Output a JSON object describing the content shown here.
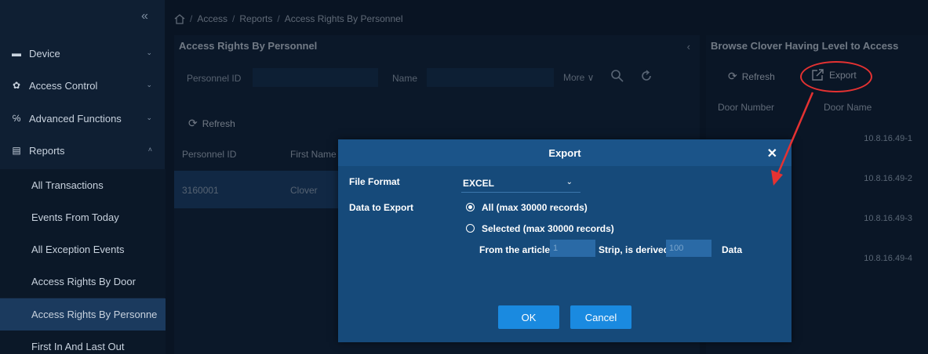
{
  "sidebar": {
    "collapse_label": "«",
    "menu": [
      {
        "icon": "device-icon",
        "glyph": "▬",
        "label": "Device",
        "chevron": "⌄"
      },
      {
        "icon": "gear-icon",
        "glyph": "✿",
        "label": "Access Control",
        "chevron": "⌄"
      },
      {
        "icon": "functions-icon",
        "glyph": "℅",
        "label": "Advanced Functions",
        "chevron": "⌄"
      },
      {
        "icon": "document-icon",
        "glyph": "▤",
        "label": "Reports",
        "chevron": "˄"
      }
    ],
    "sub_items": [
      "All Transactions",
      "Events From Today",
      "All Exception Events",
      "Access Rights By Door",
      "Access Rights By Personne",
      "First In And Last Out"
    ]
  },
  "breadcrumb": {
    "home_icon": "home-icon",
    "sep": "/",
    "items": [
      "Access",
      "Reports",
      "Access Rights By Personnel"
    ]
  },
  "left_panel": {
    "title": "Access Rights By Personnel",
    "collapse": "‹",
    "filter": {
      "personnel_id_label": "Personnel ID",
      "name_label": "Name",
      "more_label": "More ∨"
    },
    "refresh_label": "Refresh",
    "columns": [
      "Personnel ID",
      "First Name"
    ],
    "rows": [
      {
        "personnel_id": "3160001",
        "first_name": "Clover"
      }
    ]
  },
  "right_panel": {
    "title": "Browse Clover Having Level to Access",
    "refresh_label": "Refresh",
    "export_label": "Export",
    "columns": [
      "Door Number",
      "Door Name"
    ],
    "rows": [
      "10.8.16.49-1",
      "10.8.16.49-2",
      "10.8.16.49-3",
      "10.8.16.49-4"
    ]
  },
  "dialog": {
    "title": "Export",
    "close": "✕",
    "file_format_label": "File Format",
    "file_format_value": "EXCEL",
    "data_to_export_label": "Data to Export",
    "option_all": "All (max 30000 records)",
    "option_selected": "Selected (max 30000 records)",
    "from_article_label": "From the article",
    "from_value": "1",
    "strip_label": "Strip, is derived",
    "strip_value": "100",
    "data_label": "Data",
    "ok_label": "OK",
    "cancel_label": "Cancel"
  },
  "colors": {
    "accent": "#1a8ae0",
    "annotation": "#e53232",
    "dialog_bg": "#164a7a"
  }
}
